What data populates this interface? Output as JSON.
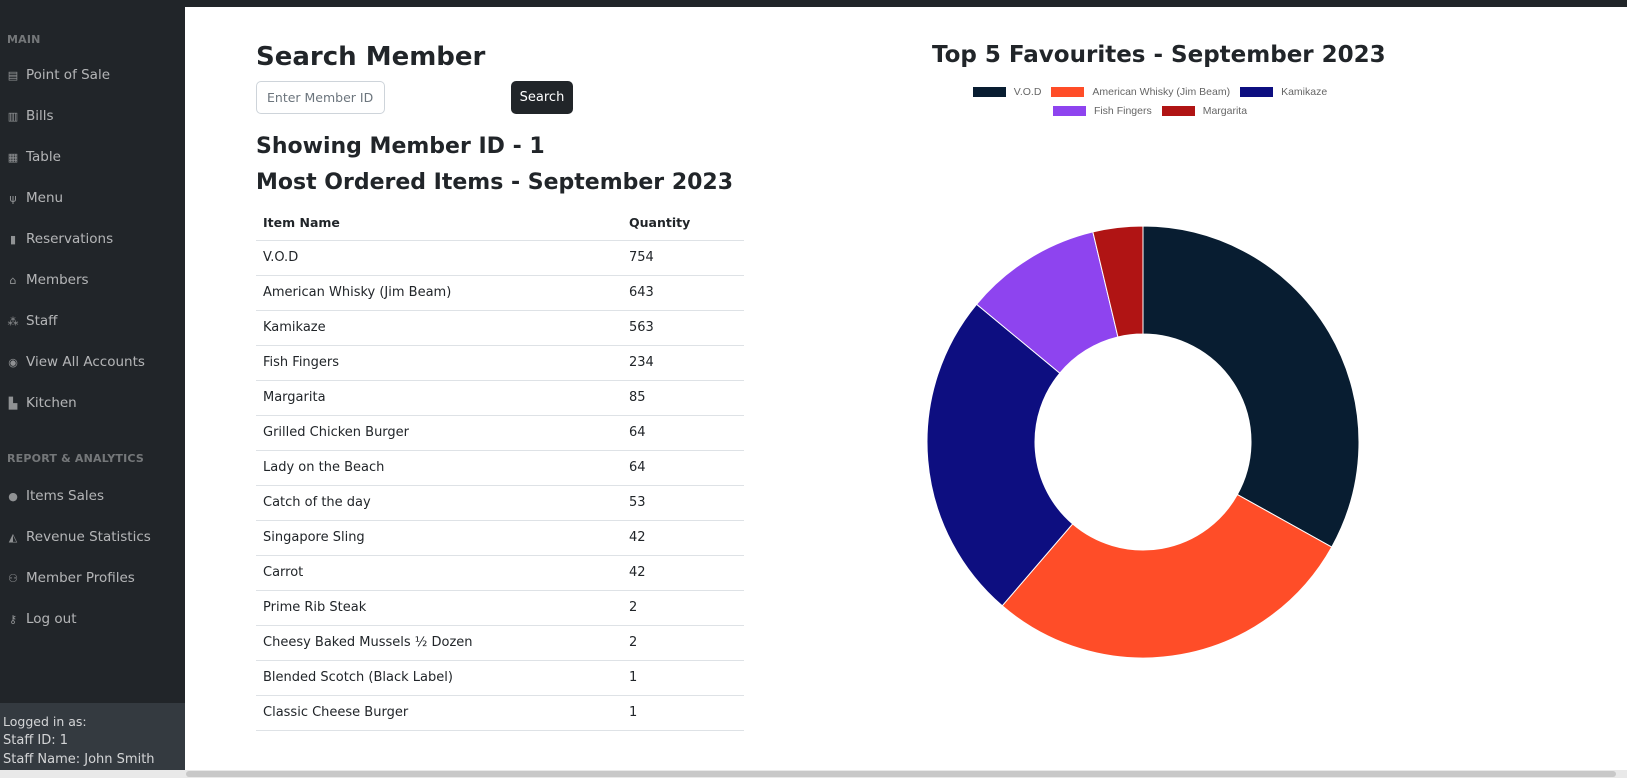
{
  "sidebar": {
    "main_heading": "MAIN",
    "report_heading": "REPORT & ANALYTICS",
    "items": [
      {
        "label": "Point of Sale",
        "icon": "cash-register-icon"
      },
      {
        "label": "Bills",
        "icon": "receipt-icon"
      },
      {
        "label": "Table",
        "icon": "table-icon"
      },
      {
        "label": "Menu",
        "icon": "utensils-icon"
      },
      {
        "label": "Reservations",
        "icon": "book-icon"
      },
      {
        "label": "Members",
        "icon": "home-icon"
      },
      {
        "label": "Staff",
        "icon": "people-icon"
      },
      {
        "label": "View All Accounts",
        "icon": "eye-icon"
      },
      {
        "label": "Kitchen",
        "icon": "building-icon"
      }
    ],
    "report_items": [
      {
        "label": "Items Sales",
        "icon": "fire-icon"
      },
      {
        "label": "Revenue Statistics",
        "icon": "chart-area-icon"
      },
      {
        "label": "Member Profiles",
        "icon": "users-icon"
      },
      {
        "label": "Log out",
        "icon": "key-icon"
      }
    ],
    "footer": {
      "logged_in_as": "Logged in as:",
      "staff_id": "Staff ID: 1",
      "staff_name": "Staff Name: John Smith"
    }
  },
  "main": {
    "title": "Search Member",
    "search_placeholder": "Enter Member ID",
    "search_button": "Search",
    "showing": "Showing Member ID - 1",
    "table_title": "Most Ordered Items - September 2023",
    "columns": [
      "Item Name",
      "Quantity"
    ],
    "rows": [
      [
        "V.O.D",
        "754"
      ],
      [
        "American Whisky (Jim Beam)",
        "643"
      ],
      [
        "Kamikaze",
        "563"
      ],
      [
        "Fish Fingers",
        "234"
      ],
      [
        "Margarita",
        "85"
      ],
      [
        "Grilled Chicken Burger",
        "64"
      ],
      [
        "Lady on the Beach",
        "64"
      ],
      [
        "Catch of the day",
        "53"
      ],
      [
        "Singapore Sling",
        "42"
      ],
      [
        "Carrot",
        "42"
      ],
      [
        "Prime Rib Steak",
        "2"
      ],
      [
        "Cheesy Baked Mussels ½ Dozen",
        "2"
      ],
      [
        "Blended Scotch (Black Label)",
        "1"
      ],
      [
        "Classic Cheese Burger",
        "1"
      ]
    ]
  },
  "chart_data": {
    "type": "pie",
    "title": "Top 5 Favourites - September 2023",
    "categories": [
      "V.O.D",
      "American Whisky (Jim Beam)",
      "Kamikaze",
      "Fish Fingers",
      "Margarita"
    ],
    "values": [
      754,
      643,
      563,
      234,
      85
    ],
    "colors": [
      "#081d31",
      "#ff4d28",
      "#0d0e80",
      "#8e44ef",
      "#b01414"
    ],
    "donut": true,
    "legend_position": "top"
  }
}
